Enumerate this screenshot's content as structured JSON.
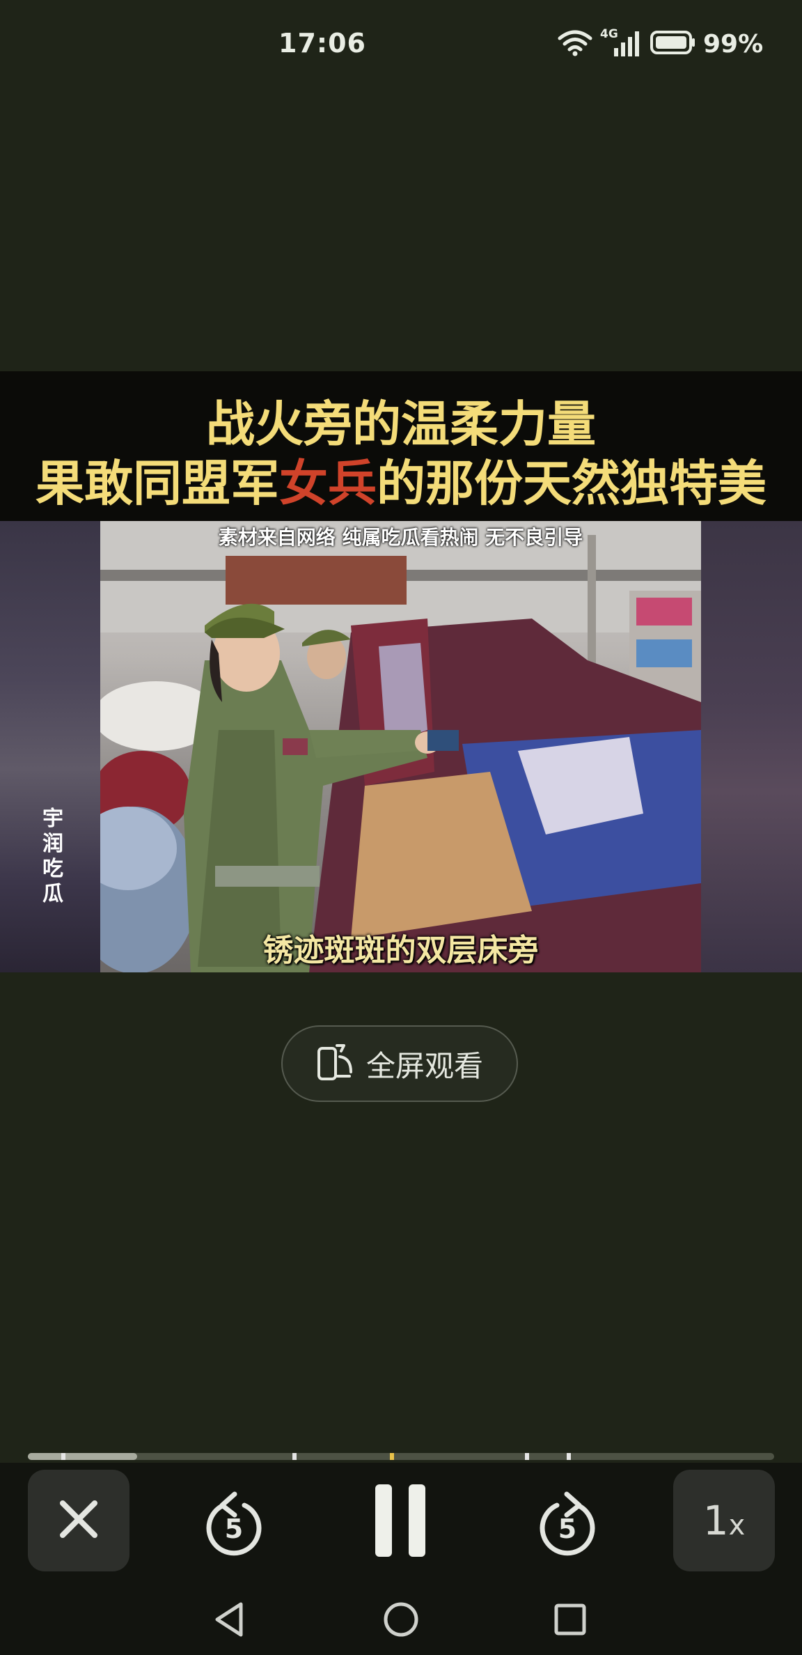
{
  "status_bar": {
    "time": "17:06",
    "network": "4G",
    "battery": "99%"
  },
  "video": {
    "title_line1": "战火旁的温柔力量",
    "title_line2_prefix": "果敢同盟军",
    "title_line2_highlight": "女兵",
    "title_line2_suffix": "的那份天然独特美",
    "disclaimer": "素材来自网络 纯属吃瓜看热闹 无不良引导",
    "watermark": "宇润吃瓜",
    "subtitle": "锈迹斑斑的双层床旁",
    "highlight_color": "#d0432a",
    "title_color": "#f4dc79"
  },
  "fullscreen": {
    "label": "全屏观看",
    "icon": "rotate-screen-icon"
  },
  "playback": {
    "progress": 0.146,
    "rewind_seconds": "5",
    "forward_seconds": "5",
    "speed": "1",
    "speed_suffix": "x"
  },
  "nav": {
    "back_icon": "back-triangle-icon",
    "home_icon": "home-circle-icon",
    "recents_icon": "recents-square-icon"
  }
}
